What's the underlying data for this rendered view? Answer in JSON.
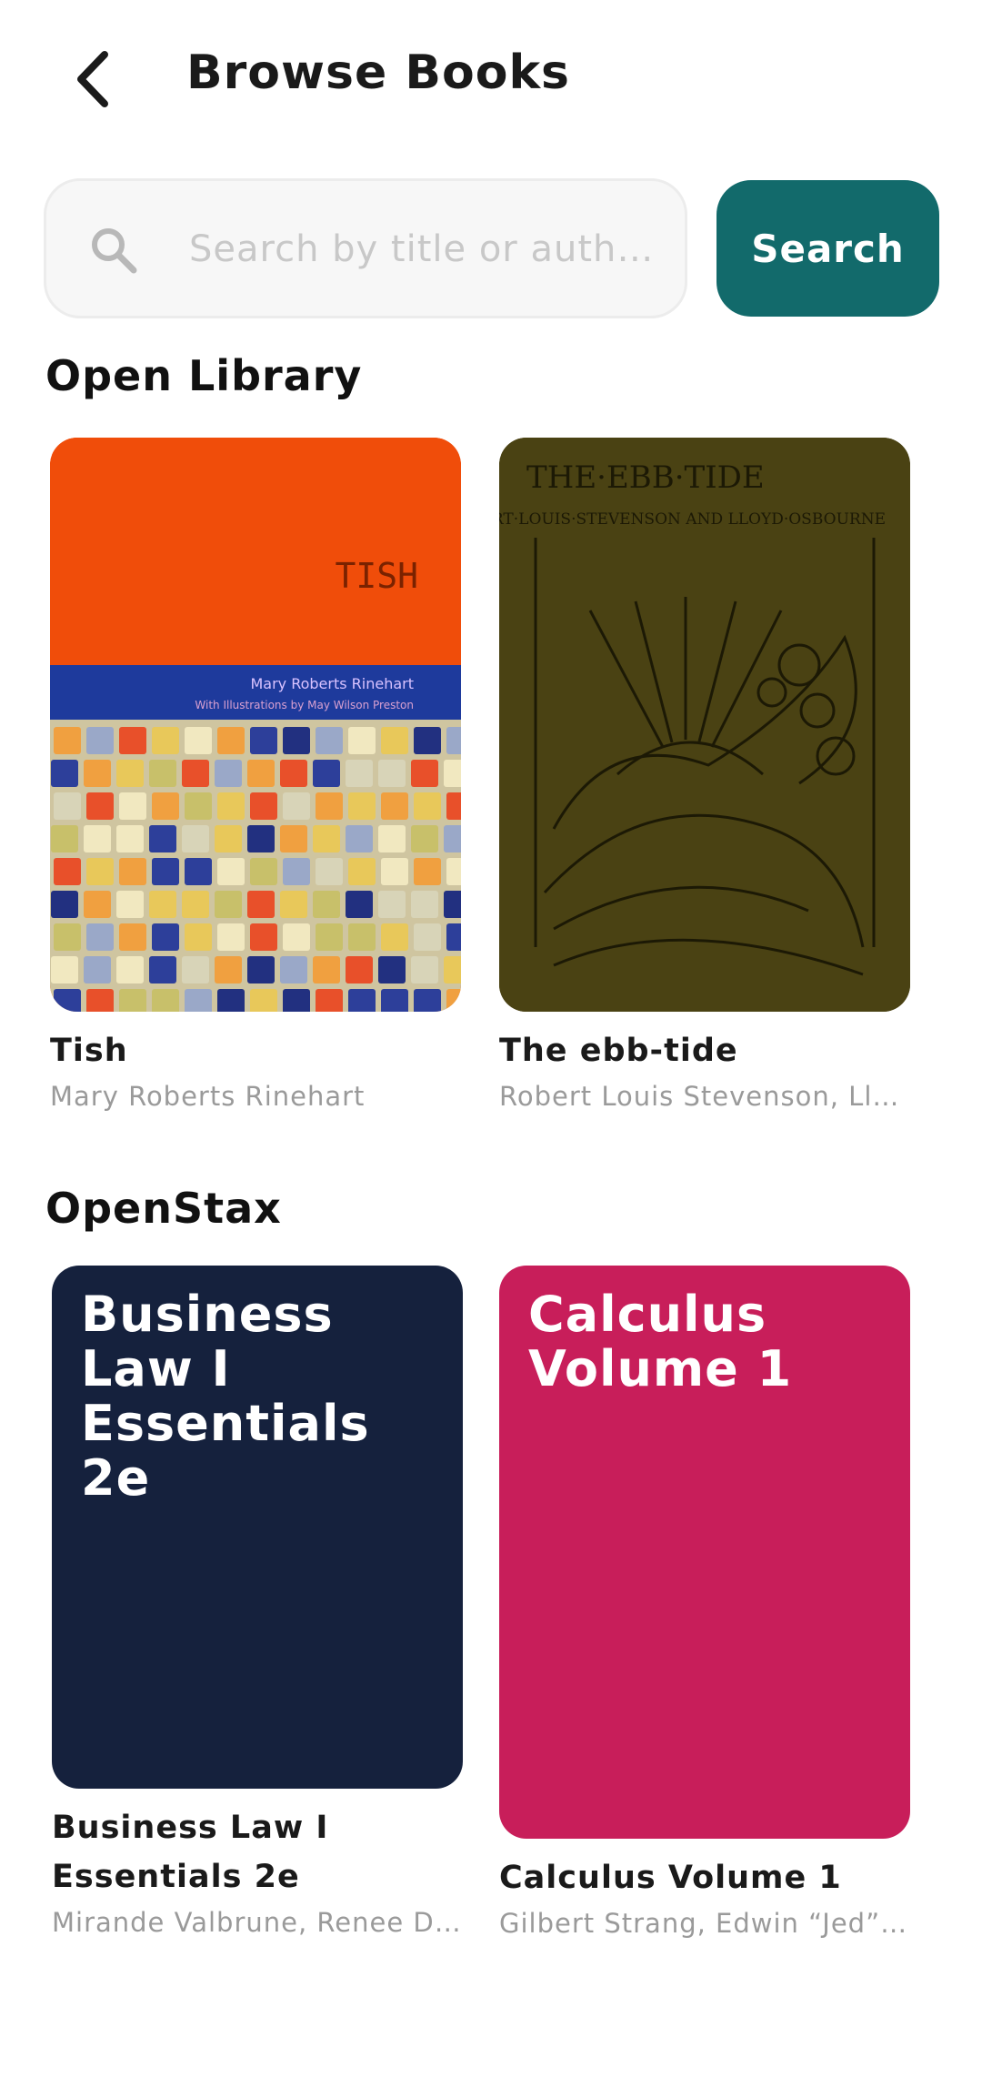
{
  "header": {
    "title": "Browse Books",
    "back_icon": "chevron-left-icon"
  },
  "search": {
    "placeholder": "Search by title or auth…",
    "value": "",
    "button_label": "Search",
    "icon": "search-icon",
    "button_color": "#126a6b"
  },
  "sections": [
    {
      "title": "Open Library",
      "books": [
        {
          "title": "Tish",
          "author": "Mary Roberts Rinehart",
          "cover": {
            "title": "TISH",
            "author": "Mary Roberts Rinehart",
            "subtitle": "With Illustrations by May Wilson Preston",
            "color": "#f04d0a"
          }
        },
        {
          "title": "The  ebb-tide",
          "author": "Robert Louis Stevenson, Llo…",
          "cover": {
            "title": "THE·EBB·TIDE",
            "author": "BY ROBERT·LOUIS·STEVENSON AND LLOYD·OSBOURNE",
            "color": "#4a4213"
          }
        }
      ]
    },
    {
      "title": "OpenStax",
      "books": [
        {
          "title": "Business Law I Essentials 2e",
          "author": "Mirande Valbrune, Renee D…",
          "cover": {
            "title": "Business Law I Essentials 2e",
            "color": "#15213d"
          }
        },
        {
          "title": "Calculus Volume 1",
          "author": "Gilbert Strang, Edwin “Jed” …",
          "cover": {
            "title": "Calculus Volume 1",
            "color": "#c81e5a"
          }
        }
      ]
    }
  ]
}
